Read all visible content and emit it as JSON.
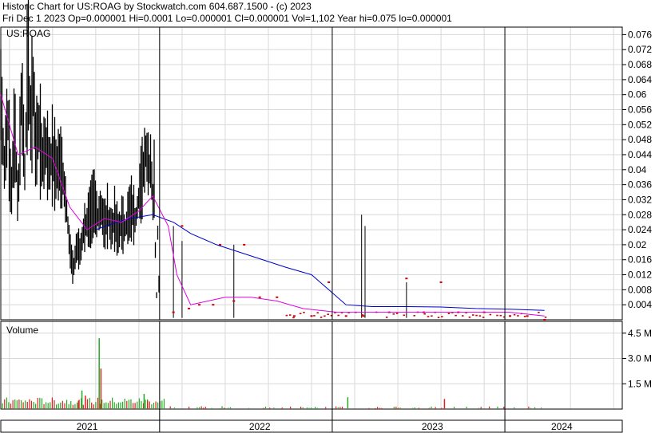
{
  "header": {
    "line1": "Historic Chart for US:ROAG by Stockwatch.com 604.687.1500 - (c) 2023",
    "line2": "Fri Dec  1 2023   Op=0.000001   Hi=0.0001   Lo=0.000001   Cl=0.000001   Vol=1,102   Year hi=0.075   lo=0.000001"
  },
  "colors": {
    "price": "#000000",
    "ma_short": "#e000e0",
    "ma_long": "#0000cc",
    "red_price": "#cc0000",
    "vol_up": "#22aa22",
    "vol_down": "#dd2222",
    "grid": "#d8d8d8",
    "axis": "#000000"
  },
  "chart_data": [
    {
      "type": "line",
      "panel": "price",
      "title": "US:ROAG",
      "ylim": [
        0,
        0.078
      ],
      "yticks": [
        "0.004",
        "0.008",
        "0.012",
        "0.016",
        "0.02",
        "0.024",
        "0.028",
        "0.032",
        "0.036",
        "0.04",
        "0.044",
        "0.048",
        "0.052",
        "0.056",
        "0.06",
        "0.064",
        "0.068",
        "0.072",
        "0.076"
      ],
      "x_range": [
        2020.95,
        2024.55
      ],
      "price_points": [
        [
          2020.95,
          0.06
        ],
        [
          2020.97,
          0.04
        ],
        [
          2020.99,
          0.055
        ],
        [
          2021.01,
          0.032
        ],
        [
          2021.03,
          0.052
        ],
        [
          2021.05,
          0.03
        ],
        [
          2021.07,
          0.062
        ],
        [
          2021.09,
          0.038
        ],
        [
          2021.1,
          0.06
        ],
        [
          2021.11,
          0.075
        ],
        [
          2021.12,
          0.05
        ],
        [
          2021.14,
          0.064
        ],
        [
          2021.15,
          0.045
        ],
        [
          2021.17,
          0.052
        ],
        [
          2021.19,
          0.042
        ],
        [
          2021.21,
          0.047
        ],
        [
          2021.23,
          0.041
        ],
        [
          2021.25,
          0.044
        ],
        [
          2021.27,
          0.04
        ],
        [
          2021.29,
          0.042
        ],
        [
          2021.31,
          0.038
        ],
        [
          2021.33,
          0.03
        ],
        [
          2021.35,
          0.019
        ],
        [
          2021.37,
          0.013
        ],
        [
          2021.39,
          0.02
        ],
        [
          2021.41,
          0.018
        ],
        [
          2021.43,
          0.024
        ],
        [
          2021.45,
          0.026
        ],
        [
          2021.47,
          0.028
        ],
        [
          2021.49,
          0.032
        ],
        [
          2021.51,
          0.027
        ],
        [
          2021.53,
          0.03
        ],
        [
          2021.55,
          0.025
        ],
        [
          2021.57,
          0.028
        ],
        [
          2021.59,
          0.024
        ],
        [
          2021.61,
          0.027
        ],
        [
          2021.63,
          0.023
        ],
        [
          2021.65,
          0.026
        ],
        [
          2021.67,
          0.024
        ],
        [
          2021.69,
          0.028
        ],
        [
          2021.71,
          0.03
        ],
        [
          2021.73,
          0.026
        ],
        [
          2021.75,
          0.033
        ],
        [
          2021.77,
          0.038
        ],
        [
          2021.79,
          0.045
        ],
        [
          2021.81,
          0.04
        ],
        [
          2021.82,
          0.043
        ],
        [
          2021.83,
          0.03
        ],
        [
          2021.84,
          0.039
        ],
        [
          2021.85,
          0.001
        ],
        [
          2021.86,
          0.025
        ],
        [
          2021.87,
          0.0
        ]
      ],
      "volume_spikes": [
        [
          2021.4,
          0.5
        ],
        [
          2021.42,
          1.1
        ],
        [
          2021.44,
          0.8
        ],
        [
          2021.52,
          4.2
        ],
        [
          2021.53,
          2.4
        ],
        [
          2021.78,
          0.9
        ],
        [
          2021.8,
          0.5
        ],
        [
          2022.96,
          0.7
        ],
        [
          2023.52,
          0.6
        ]
      ],
      "red_points": [
        [
          2021.95,
          0.002
        ],
        [
          2022.0,
          0.025
        ],
        [
          2022.04,
          0.003
        ],
        [
          2022.1,
          0.004
        ],
        [
          2022.18,
          0.004
        ],
        [
          2022.22,
          0.02
        ],
        [
          2022.3,
          0.005
        ],
        [
          2022.36,
          0.02
        ],
        [
          2022.45,
          0.006
        ],
        [
          2022.55,
          0.006
        ],
        [
          2022.65,
          0.001
        ],
        [
          2022.75,
          0.001
        ],
        [
          2022.85,
          0.01
        ],
        [
          2022.95,
          0.001
        ],
        [
          2023.05,
          0.001
        ],
        [
          2023.2,
          0.002
        ],
        [
          2023.3,
          0.011
        ],
        [
          2023.4,
          0.002
        ],
        [
          2023.5,
          0.01
        ],
        [
          2023.6,
          0.002
        ],
        [
          2023.75,
          0.002
        ],
        [
          2023.9,
          0.001
        ],
        [
          2024.0,
          0.001
        ],
        [
          2024.1,
          0.0
        ]
      ],
      "spikes": [
        [
          2021.95,
          0.025
        ],
        [
          2022.0,
          0.021
        ],
        [
          2022.3,
          0.02
        ],
        [
          2023.04,
          0.028
        ],
        [
          2023.06,
          0.025
        ],
        [
          2023.3,
          0.01
        ]
      ],
      "ma_short": [
        [
          2020.95,
          0.06
        ],
        [
          2021.05,
          0.044
        ],
        [
          2021.15,
          0.046
        ],
        [
          2021.25,
          0.043
        ],
        [
          2021.35,
          0.03
        ],
        [
          2021.45,
          0.024
        ],
        [
          2021.55,
          0.027
        ],
        [
          2021.65,
          0.026
        ],
        [
          2021.75,
          0.029
        ],
        [
          2021.83,
          0.033
        ],
        [
          2021.92,
          0.025
        ],
        [
          2021.97,
          0.012
        ],
        [
          2022.05,
          0.004
        ],
        [
          2022.15,
          0.005
        ],
        [
          2022.25,
          0.006
        ],
        [
          2022.4,
          0.006
        ],
        [
          2022.55,
          0.005
        ],
        [
          2022.7,
          0.003
        ],
        [
          2022.9,
          0.002
        ],
        [
          2023.1,
          0.002
        ],
        [
          2023.3,
          0.002
        ],
        [
          2023.5,
          0.002
        ],
        [
          2023.7,
          0.002
        ],
        [
          2023.9,
          0.002
        ],
        [
          2024.1,
          0.001
        ]
      ],
      "ma_long": [
        [
          2021.5,
          0.024
        ],
        [
          2021.62,
          0.026
        ],
        [
          2021.7,
          0.027
        ],
        [
          2021.83,
          0.028
        ],
        [
          2021.95,
          0.026
        ],
        [
          2022.05,
          0.023
        ],
        [
          2022.2,
          0.02
        ],
        [
          2022.4,
          0.017
        ],
        [
          2022.6,
          0.014
        ],
        [
          2022.75,
          0.012
        ],
        [
          2022.85,
          0.008
        ],
        [
          2022.95,
          0.004
        ],
        [
          2023.1,
          0.0035
        ],
        [
          2023.3,
          0.0035
        ],
        [
          2023.5,
          0.0034
        ],
        [
          2023.7,
          0.003
        ],
        [
          2023.9,
          0.0028
        ],
        [
          2024.1,
          0.0025
        ]
      ]
    },
    {
      "type": "bar",
      "panel": "volume",
      "title": "Volume",
      "ylim": [
        0,
        5.2
      ],
      "yticks": [
        "1.5 M",
        "3.0 M",
        "4.5 M"
      ],
      "ytick_values": [
        1.5,
        3.0,
        4.5
      ]
    }
  ],
  "xaxis": {
    "labels": [
      "2021",
      "2022",
      "2023",
      "2024"
    ],
    "label_positions": [
      2021.45,
      2022.45,
      2023.45,
      2024.2
    ],
    "dividers": [
      2021.87,
      2022.87,
      2023.87
    ]
  }
}
